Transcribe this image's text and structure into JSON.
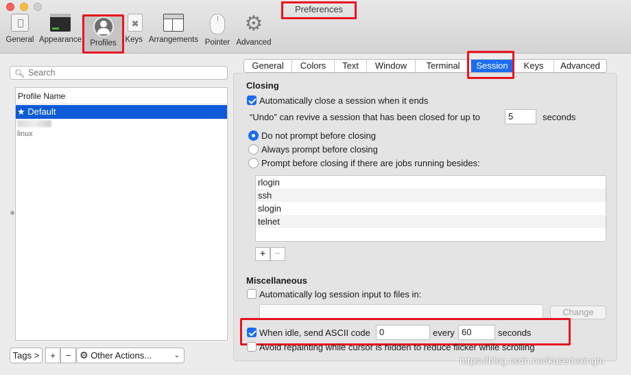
{
  "window": {
    "title": "Preferences"
  },
  "toolbar": {
    "general": "General",
    "appearance": "Appearance",
    "profiles": "Profiles",
    "keys": "Keys",
    "arrangements": "Arrangements",
    "pointer": "Pointer",
    "advanced": "Advanced"
  },
  "sidebar": {
    "search_placeholder": "Search",
    "list_header": "Profile Name",
    "profiles": [
      {
        "label": "Default",
        "selected": true
      },
      {
        "label": "linux",
        "selected": false
      }
    ],
    "tags_button": "Tags >",
    "add_button": "+",
    "remove_button": "−",
    "other_actions": "Other Actions..."
  },
  "tabs": [
    "General",
    "Colors",
    "Text",
    "Window",
    "Terminal",
    "Session",
    "Keys",
    "Advanced"
  ],
  "active_tab": "Session",
  "session": {
    "closing_title": "Closing",
    "auto_close_label": "Automatically close a session when it ends",
    "auto_close_checked": true,
    "undo_prefix": "“Undo” can revive a session that has been closed for up to",
    "undo_value": "5",
    "undo_suffix": "seconds",
    "prompt_options": [
      {
        "label": "Do not prompt before closing",
        "selected": true
      },
      {
        "label": "Always prompt before closing",
        "selected": false
      },
      {
        "label": "Prompt before closing if there are jobs running besides:",
        "selected": false
      }
    ],
    "jobs": [
      "rlogin",
      "ssh",
      "slogin",
      "telnet"
    ],
    "jobs_add": "+",
    "jobs_remove": "−",
    "misc_title": "Miscellaneous",
    "log_label": "Automatically log session input to files in:",
    "log_checked": false,
    "log_path": "",
    "change_button": "Change",
    "idle_label": "When idle, send ASCII code",
    "idle_checked": true,
    "idle_code": "0",
    "idle_every": "every",
    "idle_seconds_value": "60",
    "idle_seconds_label": "seconds",
    "avoid_repaint_label": "Avoid repainting while cursor is hidden to reduce flicker while scrolling",
    "avoid_repaint_checked": false
  },
  "watermark": "https://blog.csdn.net/kusedexingfu",
  "colors": {
    "accent": "#1b6cf2",
    "highlight": "#e8141f",
    "selection": "#0d5bd8"
  }
}
